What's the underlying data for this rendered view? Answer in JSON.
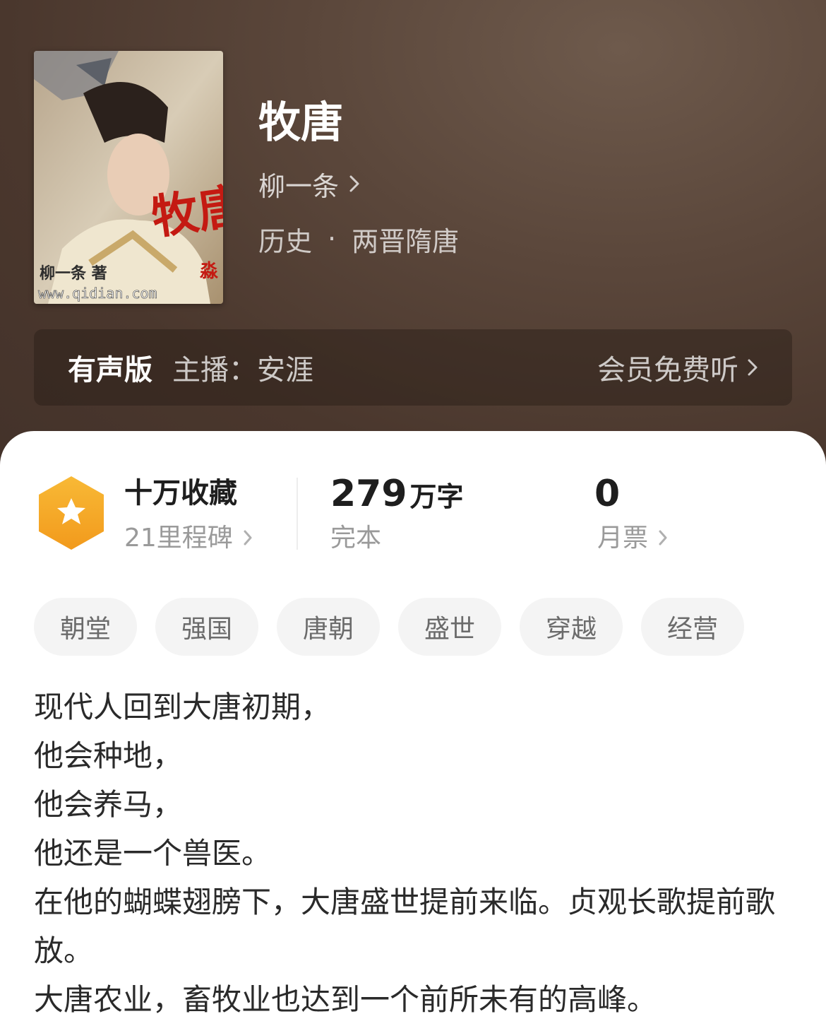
{
  "book": {
    "title": "牧唐",
    "author": "柳一条",
    "category": "历史",
    "separator": "·",
    "subcategory": "两晋隋唐",
    "cover": {
      "title_art": "牧唐",
      "author_art": "柳一条 著",
      "site": "www.qidian.com",
      "mark": "淼"
    }
  },
  "audio": {
    "tag": "有声版",
    "host": "主播：安涯",
    "cta": "会员免费听"
  },
  "stats": {
    "favorites": {
      "title": "十万收藏",
      "sub": "21里程碑"
    },
    "words": {
      "number": "279",
      "unit": "万字",
      "sub": "完本"
    },
    "tickets": {
      "number": "0",
      "sub": "月票"
    }
  },
  "tags": [
    "朝堂",
    "强国",
    "唐朝",
    "盛世",
    "穿越",
    "经营"
  ],
  "synopsis": [
    "现代人回到大唐初期，",
    "他会种地，",
    "他会养马，",
    "他还是一个兽医。",
    "在他的蝴蝶翅膀下，大唐盛世提前来临。贞观长歌提前歌放。",
    "大唐农业，畜牧业也达到一个前所未有的高峰。"
  ],
  "colors": {
    "header_bg": "#5b473b",
    "badge": "#f5a623",
    "text_primary": "#1e1e1e",
    "text_secondary": "#9a9a9a",
    "tag_bg": "#f4f4f4",
    "cover_title_red": "#c41a12"
  },
  "icons": [
    "chevron-right-icon",
    "star-badge-icon"
  ]
}
